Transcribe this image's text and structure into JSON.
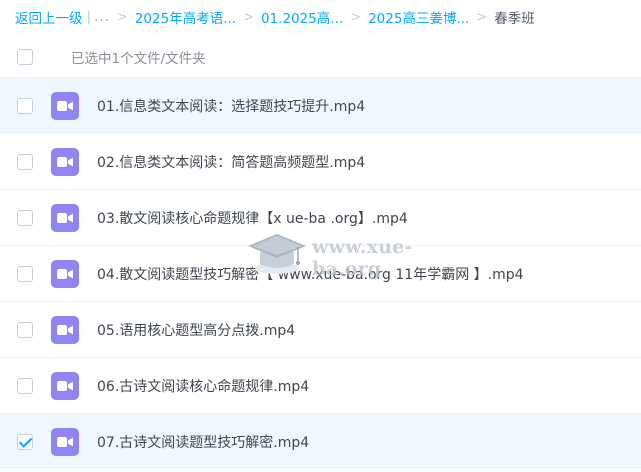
{
  "breadcrumb": {
    "back_label": "返回上一级",
    "separator": "|",
    "more_label": "...",
    "arrow": ">",
    "items": [
      "2025年高考语...",
      "01.2025高...",
      "2025高三姜博..."
    ],
    "current": "春季班"
  },
  "selection": {
    "status_text": "已选中1个文件/文件夹"
  },
  "files": [
    {
      "name": "01.信息类文本阅读：选择题技巧提升.mp4",
      "checked": false
    },
    {
      "name": "02.信息类文本阅读：简答题高频题型.mp4",
      "checked": false
    },
    {
      "name": "03.散文阅读核心命题规律【x ue-ba .org】.mp4",
      "checked": false
    },
    {
      "name": "04.散文阅读题型技巧解密【 www.xue-ba.org 11年学霸网 】.mp4",
      "checked": false
    },
    {
      "name": "05.语用核心题型高分点拨.mp4",
      "checked": false
    },
    {
      "name": "06.古诗文阅读核心命题规律.mp4",
      "checked": false
    },
    {
      "name": "07.古诗文阅读题型技巧解密.mp4",
      "checked": true
    }
  ],
  "watermark": {
    "text": "www.xue-ba.org"
  },
  "colors": {
    "link": "#06a7ff",
    "video_icon": "#8f86f3",
    "row_highlight": "#f0f8ff"
  }
}
